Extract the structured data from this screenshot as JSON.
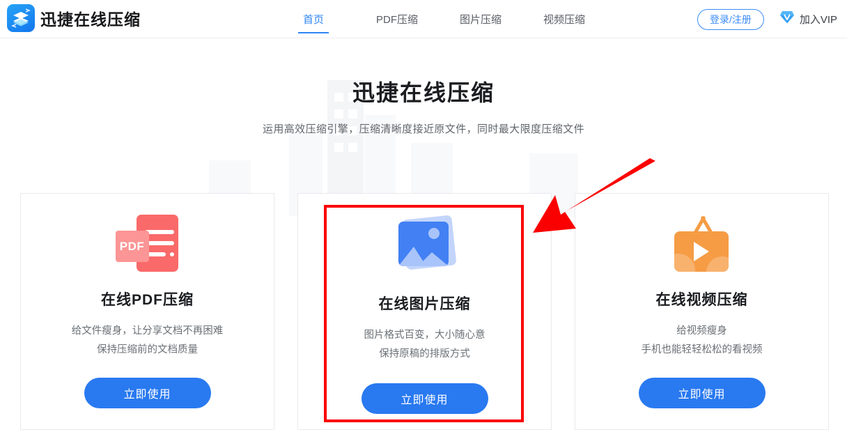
{
  "header": {
    "logo_icon": "layers-stack-icon",
    "brand": "迅捷在线压缩",
    "nav": [
      {
        "label": "首页",
        "active": true
      },
      {
        "label": "PDF压缩",
        "active": false
      },
      {
        "label": "图片压缩",
        "active": false
      },
      {
        "label": "视频压缩",
        "active": false
      }
    ],
    "login_label": "登录/注册",
    "vip_label": "加入VIP",
    "vip_icon": "diamond-icon",
    "accent_color": "#2f86f6"
  },
  "hero": {
    "title": "迅捷在线压缩",
    "subtitle": "运用高效压缩引擎，压缩清晰度接近原文件，同时最大限度压缩文件"
  },
  "cards": [
    {
      "icon": "pdf-file-icon",
      "icon_label": "PDF",
      "icon_color": "#fa6a6a",
      "title": "在线PDF压缩",
      "desc_line1": "给文件瘦身，让分享文档不再困难",
      "desc_line2": "保持压缩前的文档质量",
      "button_label": "立即使用",
      "highlighted": false
    },
    {
      "icon": "image-picture-icon",
      "icon_label": "",
      "icon_color": "#4280f4",
      "title": "在线图片压缩",
      "desc_line1": "图片格式百变，大小随心意",
      "desc_line2": "保持原稿的排版方式",
      "button_label": "立即使用",
      "highlighted": true
    },
    {
      "icon": "tv-video-icon",
      "icon_label": "",
      "icon_color": "#f59c45",
      "title": "在线视频压缩",
      "desc_line1": "给视频瘦身",
      "desc_line2": "手机也能轻轻松松的看视频",
      "button_label": "立即使用",
      "highlighted": false
    }
  ],
  "annotations": {
    "highlight_color": "#fb0000",
    "rect_target": "在线图片压缩",
    "arrow_points_to": "在线图片压缩"
  },
  "theme": {
    "button_color": "#2979f0",
    "page_background": "#ffffff"
  }
}
